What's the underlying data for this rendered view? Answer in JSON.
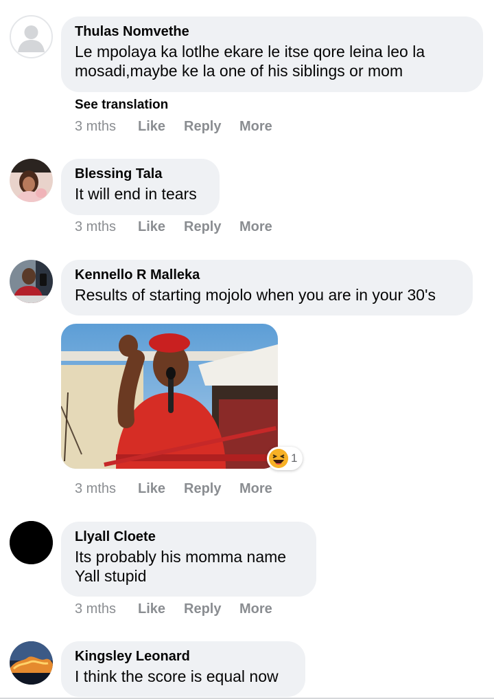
{
  "comments": [
    {
      "author": "Thulas Nomvethe",
      "text": "Le mpolaya ka lotlhe ekare le itse qore leina leo la\nmosadi,maybe ke la one of his siblings or mom",
      "see_translation": "See translation",
      "time": "3 mths",
      "like": "Like",
      "reply": "Reply",
      "more": "More",
      "avatar": "default-profile-icon"
    },
    {
      "author": "Blessing Tala",
      "text": "It will end in tears",
      "time": "3 mths",
      "like": "Like",
      "reply": "Reply",
      "more": "More",
      "avatar": "profile-photo"
    },
    {
      "author": "Kennello R Malleka",
      "text": "Results of starting mojolo when you are in your 30's",
      "time": "3 mths",
      "like": "Like",
      "reply": "Reply",
      "more": "More",
      "avatar": "profile-photo",
      "attachment": {
        "type": "image",
        "reaction_icon": "laughing-emoji-icon",
        "reaction_count": "1"
      }
    },
    {
      "author": "Llyall Cloete",
      "text": "Its probably his momma name\nYall stupid",
      "time": "3 mths",
      "like": "Like",
      "reply": "Reply",
      "more": "More",
      "avatar": "black-profile-photo"
    },
    {
      "author": "Kingsley Leonard",
      "text": "I think the score is equal now",
      "avatar": "landscape-profile-photo"
    }
  ],
  "colors": {
    "bubble": "#eff1f4",
    "meta_text": "#8a8d91",
    "text": "#050505"
  }
}
